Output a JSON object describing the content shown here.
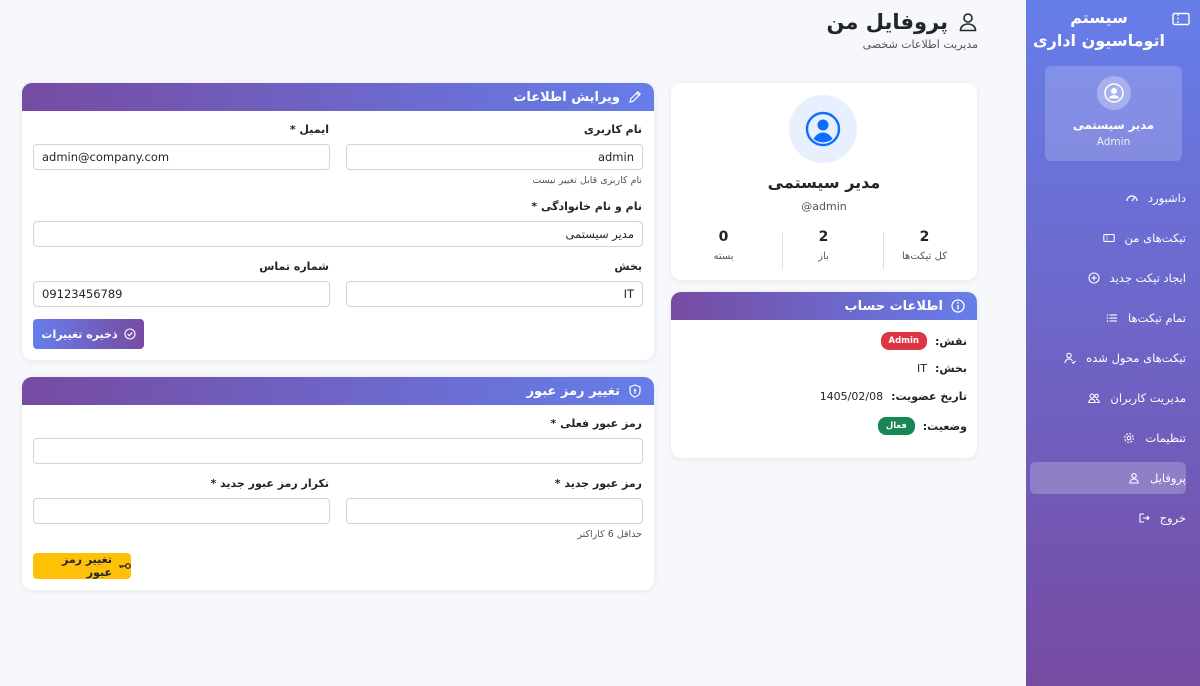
{
  "sidebar": {
    "title": "سیستم اتوماسیون اداری",
    "user": {
      "name": "مدیر سیستمی",
      "role": "Admin"
    },
    "items": [
      {
        "label": "داشبورد",
        "icon": "dashboard-icon"
      },
      {
        "label": "تیکت‌های من",
        "icon": "ticket-icon"
      },
      {
        "label": "ایجاد تیکت جدید",
        "icon": "plus-circle-icon"
      },
      {
        "label": "تمام تیکت‌ها",
        "icon": "list-icon"
      },
      {
        "label": "تیکت‌های محول شده",
        "icon": "user-check-icon"
      },
      {
        "label": "مدیریت کاربران",
        "icon": "users-icon"
      },
      {
        "label": "تنظیمات",
        "icon": "gear-icon"
      },
      {
        "label": "پروفایل",
        "icon": "person-icon",
        "active": true
      },
      {
        "label": "خروج",
        "icon": "logout-icon"
      }
    ]
  },
  "header": {
    "title": "پروفایل من",
    "subtitle": "مدیریت اطلاعات شخصی"
  },
  "profile": {
    "name": "مدیر سیستمی",
    "username": "admin@",
    "stats": [
      {
        "value": "2",
        "label": "کل تیکت‌ها"
      },
      {
        "value": "2",
        "label": "باز"
      },
      {
        "value": "0",
        "label": "بسته"
      }
    ]
  },
  "account": {
    "title": "اطلاعات حساب",
    "role_label": "نقش:",
    "role_value": "Admin",
    "dept_label": "بخش:",
    "dept_value": "IT",
    "joined_label": "تاریخ عضویت:",
    "joined_value": "1405/02/08",
    "status_label": "وضعیت:",
    "status_value": "فعال"
  },
  "edit": {
    "title": "ویرایش اطلاعات",
    "username_label": "نام کاربری",
    "username_value": "admin",
    "username_hint": "نام کاربری قابل تغییر نیست",
    "email_label": "ایمیل *",
    "email_value": "admin@company.com",
    "fullname_label": "نام و نام خانوادگی *",
    "fullname_value": "مدیر سیستمی",
    "dept_label": "بخش",
    "dept_value": "IT",
    "phone_label": "شماره تماس",
    "phone_value": "09123456789",
    "save_label": "ذخیره تغییرات"
  },
  "password": {
    "title": "تغییر رمز عبور",
    "current_label": "رمز عبور فعلی *",
    "new_label": "رمز عبور جدید *",
    "new_hint": "حداقل 6 کاراکتر",
    "confirm_label": "تکرار رمز عبور جدید *",
    "submit_label": "تغییر رمز عبور"
  },
  "colors": {
    "primary": "#667eea",
    "secondary": "#764ba2",
    "danger": "#dc3545",
    "success": "#198754",
    "warning": "#ffc107"
  }
}
